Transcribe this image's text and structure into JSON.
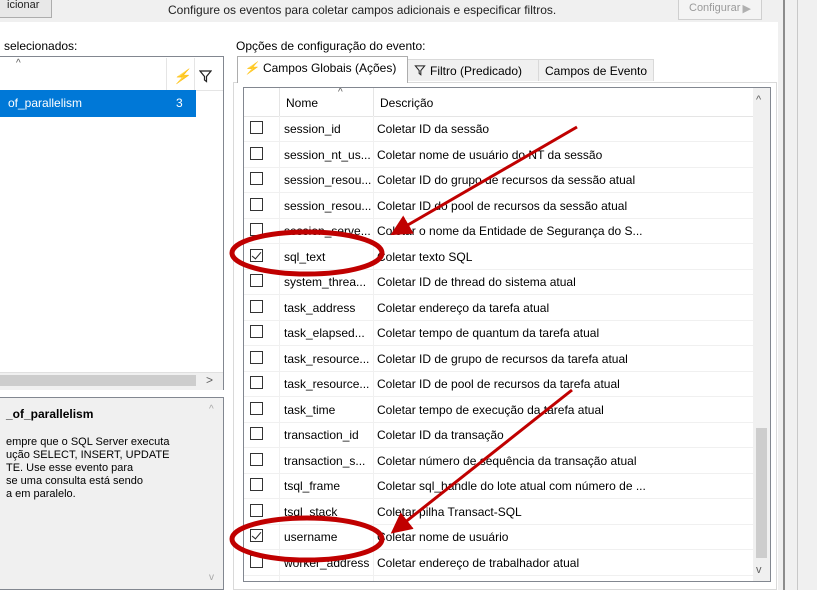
{
  "toolbar": {
    "left_button_label": "icionar",
    "hint_text": "Configure os eventos para coletar campos adicionais e especificar filtros.",
    "configure_button_label": "Configurar",
    "configure_arrow": "▶"
  },
  "left_panel": {
    "label": "selecionados:",
    "sort_glyph": "^",
    "bolt_icon": "lightning-icon",
    "filter_icon": "funnel-icon",
    "selected_item": {
      "name": "of_parallelism",
      "count": "3"
    },
    "scroll_right_glyph": ">"
  },
  "description_panel": {
    "title": "_of_parallelism",
    "text": "empre que o SQL Server executa\nução SELECT, INSERT, UPDATE\nTE. Use esse evento para\n se uma consulta está sendo\na em paralelo.",
    "scroll_up_glyph": "^",
    "scroll_down_glyph": "v"
  },
  "config_panel": {
    "label": "Opções de configuração do evento:",
    "tabs": [
      {
        "label": "Campos Globais (Ações)",
        "icon": "lightning-icon",
        "active": true
      },
      {
        "label": "Filtro (Predicado)",
        "icon": "funnel-icon",
        "active": false
      },
      {
        "label": "Campos de Evento",
        "icon": "",
        "active": false
      }
    ]
  },
  "grid": {
    "columns": {
      "name": "Nome",
      "description": "Descrição"
    },
    "sort_glyph": "^",
    "scroll_up_glyph": "^",
    "scroll_down_glyph": "v",
    "rows": [
      {
        "checked": false,
        "name": "session_id",
        "description": "Coletar ID da sessão"
      },
      {
        "checked": false,
        "name": "session_nt_us...",
        "description": "Coletar nome de usuário do NT da sessão"
      },
      {
        "checked": false,
        "name": "session_resou...",
        "description": "Coletar ID do grupo de recursos da sessão atual"
      },
      {
        "checked": false,
        "name": "session_resou...",
        "description": "Coletar ID do pool de recursos da sessão atual"
      },
      {
        "checked": false,
        "name": "session_serve...",
        "description": "Coletar o nome da Entidade de Segurança do S..."
      },
      {
        "checked": true,
        "name": "sql_text",
        "description": "Coletar texto SQL"
      },
      {
        "checked": false,
        "name": "system_threa...",
        "description": "Coletar ID de thread do sistema atual"
      },
      {
        "checked": false,
        "name": "task_address",
        "description": "Coletar endereço da tarefa atual"
      },
      {
        "checked": false,
        "name": "task_elapsed...",
        "description": "Coletar tempo de quantum da tarefa atual"
      },
      {
        "checked": false,
        "name": "task_resource...",
        "description": "Coletar ID de grupo de recursos da tarefa atual"
      },
      {
        "checked": false,
        "name": "task_resource...",
        "description": "Coletar ID de pool de recursos da tarefa atual"
      },
      {
        "checked": false,
        "name": "task_time",
        "description": "Coletar tempo de execução da tarefa atual"
      },
      {
        "checked": false,
        "name": "transaction_id",
        "description": "Coletar ID da transação"
      },
      {
        "checked": false,
        "name": "transaction_s...",
        "description": "Coletar número de sequência da transação atual"
      },
      {
        "checked": false,
        "name": "tsql_frame",
        "description": "Coletar sql_handle do lote atual com número de ..."
      },
      {
        "checked": false,
        "name": "tsql_stack",
        "description": "Coletar pilha Transact-SQL"
      },
      {
        "checked": true,
        "name": "username",
        "description": "Coletar nome de usuário"
      },
      {
        "checked": false,
        "name": "worker_address",
        "description": "Coletar endereço de trabalhador atual"
      }
    ]
  },
  "annotation": {
    "color": "#c00000"
  }
}
